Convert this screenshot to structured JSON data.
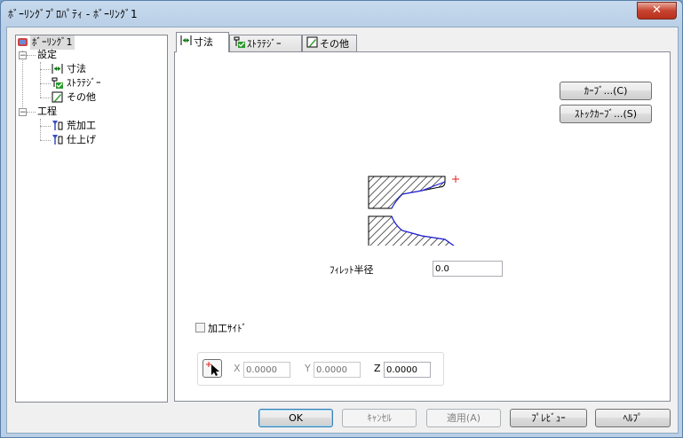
{
  "window": {
    "title": "ﾎﾞｰﾘﾝｸﾞﾌﾟﾛﾊﾟﾃｨ - ﾎﾞｰﾘﾝｸﾞ1",
    "close_label": "✕"
  },
  "tree": {
    "root": "ﾎﾞｰﾘﾝｸﾞ1",
    "settings": "設定",
    "settings_items": [
      "寸法",
      "ｽﾄﾗﾃｼﾞｰ",
      "その他"
    ],
    "process": "工程",
    "process_items": [
      "荒加工",
      "仕上げ"
    ],
    "expander": "−"
  },
  "tabs": [
    "寸法",
    "ｽﾄﾗﾃｼﾞｰ",
    "その他"
  ],
  "dimensions": {
    "curve_button": "ｶｰﾌﾞ...(C)",
    "stock_curve_button": "ｽﾄｯｸｶｰﾌﾞ...(S)",
    "fillet_label": "ﾌｨﾚｯﾄ半径",
    "fillet_value": "0.0",
    "machining_side_label": "加工ｻｲﾄﾞ",
    "x_label": "X",
    "x_value": "0.0000",
    "y_label": "Y",
    "y_value": "0.0000",
    "z_label": "Z",
    "z_value": "0.0000"
  },
  "footer": {
    "ok": "OK",
    "cancel": "ｷｬﾝｾﾙ",
    "apply": "適用(A)",
    "preview": "ﾌﾟﾚﾋﾞｭｰ",
    "help": "ﾍﾙﾌﾟ"
  }
}
